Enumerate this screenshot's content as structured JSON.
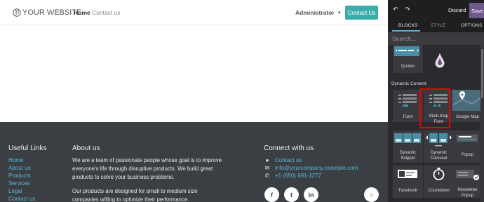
{
  "header": {
    "logo_text": "YOUR WEBSITE",
    "nav": [
      "Home",
      "Contact us"
    ],
    "user_menu": "Administrator",
    "contact_button": "Contact Us"
  },
  "footer": {
    "useful_links": {
      "title": "Useful Links",
      "items": [
        "Home",
        "About us",
        "Products",
        "Services",
        "Legal",
        "Contact us"
      ]
    },
    "about": {
      "title": "About us",
      "lines": [
        "We are a team of passionate people whose goal is to improve",
        "everyone's life through disruptive products. We build great",
        "products to solve your business problems.",
        "Our products are designed for small to medium size",
        "companies willing to optimize their performance."
      ]
    },
    "connect": {
      "title": "Connect with us",
      "items": [
        "Contact us",
        "info@yourcompany.example.com",
        "+1 (650) 691-3277"
      ]
    },
    "social": [
      "f",
      "t",
      "in",
      "home"
    ]
  },
  "editor": {
    "discard_label": "Discard",
    "save_label": "Save",
    "tabs": [
      "BLOCKS",
      "STYLE",
      "OPTIONS"
    ],
    "search_placeholder": "Search...",
    "section_label": "Dynamic Content",
    "blocks": {
      "quotes": "Quotes",
      "form": "Form",
      "multi_step_line1": "Multi-Step",
      "multi_step_line2": "Form",
      "google_map": "Google Map",
      "dynamic_snippet_line1": "Dynamic",
      "dynamic_snippet_line2": "Snippet",
      "dynamic_carousel_line1": "Dynamic",
      "dynamic_carousel_line2": "Carousel",
      "popup": "Popup",
      "facebook": "Facebook",
      "countdown": "Countdown",
      "newsletter_line1": "Newsletter",
      "newsletter_line2": "Popup"
    }
  },
  "colors": {
    "accent": "#3aadaa",
    "link": "#58b8d6",
    "footer_bg": "#3b3e43",
    "panel_bg": "#2b2b2f",
    "save_bg": "#6e5a8a",
    "highlight": "#e00000"
  }
}
